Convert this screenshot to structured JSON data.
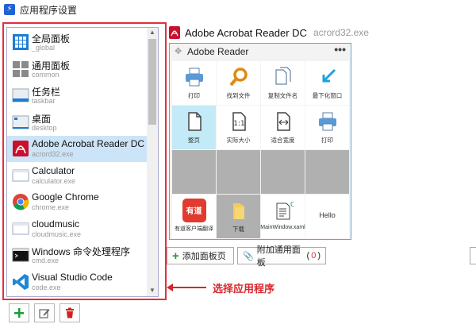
{
  "window": {
    "title": "应用程序设置"
  },
  "app_list": {
    "items": [
      {
        "name": "全局面板",
        "sub": "_global",
        "icon": "grid-blue-icon"
      },
      {
        "name": "通用面板",
        "sub": "common",
        "icon": "grid-gray-icon"
      },
      {
        "name": "任务栏",
        "sub": "taskbar",
        "icon": "taskbar-icon"
      },
      {
        "name": "桌面",
        "sub": "desktop",
        "icon": "desktop-icon"
      },
      {
        "name": "Adobe Acrobat Reader DC",
        "sub": "acrord32.exe",
        "icon": "acrobat-icon",
        "selected": true
      },
      {
        "name": "Calculator",
        "sub": "calculator.exe",
        "icon": "window-icon"
      },
      {
        "name": "Google Chrome",
        "sub": "chrome.exe",
        "icon": "chrome-icon"
      },
      {
        "name": "cloudmusic",
        "sub": "cloudmusic.exe",
        "icon": "window-icon"
      },
      {
        "name": "Windows 命令处理程序",
        "sub": "cmd.exe",
        "icon": "terminal-icon"
      },
      {
        "name": "Visual Studio Code",
        "sub": "code.exe",
        "icon": "vscode-icon"
      }
    ]
  },
  "annotation": {
    "text": "选择应用程序"
  },
  "selected_app": {
    "name": "Adobe Acrobat Reader DC",
    "exe": "acrord32.exe"
  },
  "panel": {
    "title": "Adobe Reader",
    "more": "•••",
    "cells": [
      {
        "label": "打印",
        "icon": "printer-icon"
      },
      {
        "label": "找到文件",
        "icon": "search-icon"
      },
      {
        "label": "复制文件名",
        "icon": "copy-icon"
      },
      {
        "label": "最下化窗口",
        "icon": "minimize-icon"
      },
      {
        "label": "整页",
        "icon": "page-icon",
        "highlight": true
      },
      {
        "label": "实际大小",
        "icon": "actual-size-icon"
      },
      {
        "label": "适合宽度",
        "icon": "fit-width-icon"
      },
      {
        "label": "打印",
        "icon": "printer-icon"
      },
      {
        "label": "",
        "empty": true
      },
      {
        "label": "",
        "empty": true
      },
      {
        "label": "",
        "empty": true
      },
      {
        "label": "",
        "empty": true
      },
      {
        "label": "有道客户端翻译",
        "icon": "youdao-icon",
        "glyph": "有道"
      },
      {
        "label": "下载",
        "icon": "folder-icon",
        "empty": true
      },
      {
        "label": "MainWindow.xaml",
        "icon": "csharp-file-icon"
      },
      {
        "label": "Hello",
        "icon": "",
        "textonly": true
      }
    ]
  },
  "buttons": {
    "add_panel_page": "添加面板页",
    "attach_common_panel": "附加通用面板",
    "attach_count": "0"
  }
}
